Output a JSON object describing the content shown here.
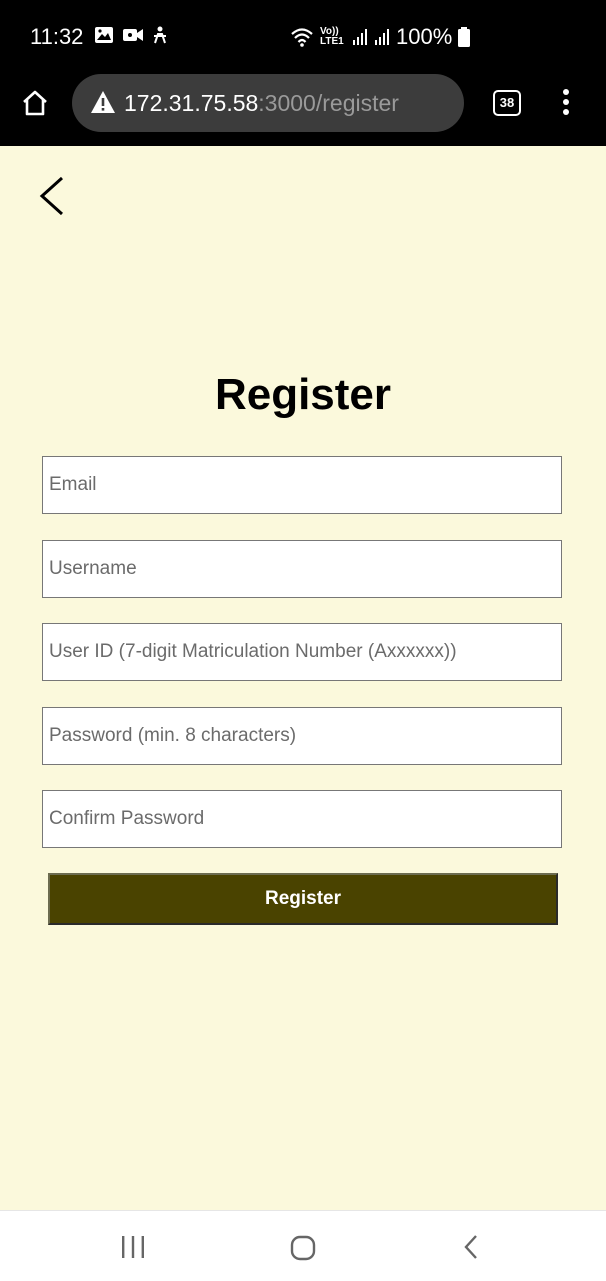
{
  "status": {
    "time": "11:32",
    "battery": "100%",
    "network": "Vo)) LTE1"
  },
  "browser": {
    "url_host": "172.31.75.58",
    "url_path": ":3000/register",
    "tab_count": "38"
  },
  "page": {
    "title": "Register",
    "fields": {
      "email_placeholder": "Email",
      "username_placeholder": "Username",
      "user_id_placeholder": "User ID (7-digit Matriculation Number (Axxxxxx))",
      "password_placeholder": "Password (min. 8 characters)",
      "confirm_password_placeholder": "Confirm Password"
    },
    "submit_label": "Register"
  },
  "colors": {
    "page_bg": "#fbf9dc",
    "button_bg": "#4a4300"
  }
}
